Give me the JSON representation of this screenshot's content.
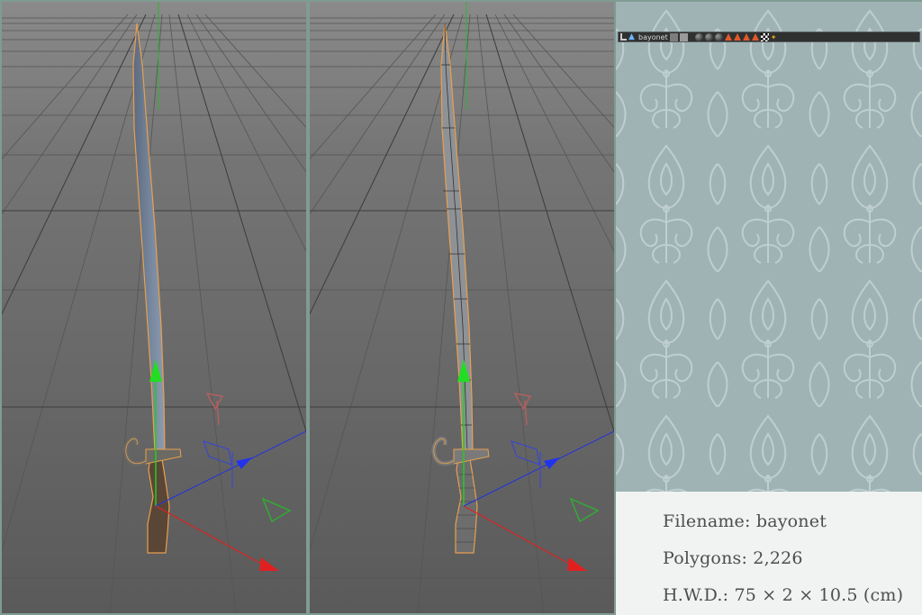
{
  "viewports": [
    {
      "name": "viewport-shaded",
      "mode": "shaded"
    },
    {
      "name": "viewport-wireframe",
      "mode": "wireframe"
    }
  ],
  "object_bar": {
    "object_name": "bayonet",
    "tags": [
      "object-icon",
      "tag-icon",
      "tag-icon",
      "material-ball-icon",
      "material-ball-icon",
      "material-ball-icon",
      "warning-triangle-icon",
      "warning-triangle-icon",
      "warning-triangle-icon",
      "warning-triangle-icon",
      "checker-icon",
      "star-icon"
    ]
  },
  "info": {
    "filename": "Filename: bayonet",
    "polygons": "Polygons: 2,226",
    "hwd": "H.W.D.: 75 × 2 × 10.5 (cm)"
  },
  "colors": {
    "frame": "#7f9c92",
    "viewport_bg": "#666666",
    "grid_line": "#575757",
    "selection_outline": "#e8a050",
    "axis_y": "#22cc22",
    "axis_x": "#e02020",
    "axis_z": "#2233dd",
    "pattern_bg": "#9fb3b5",
    "info_bg": "#f0f3f1"
  }
}
